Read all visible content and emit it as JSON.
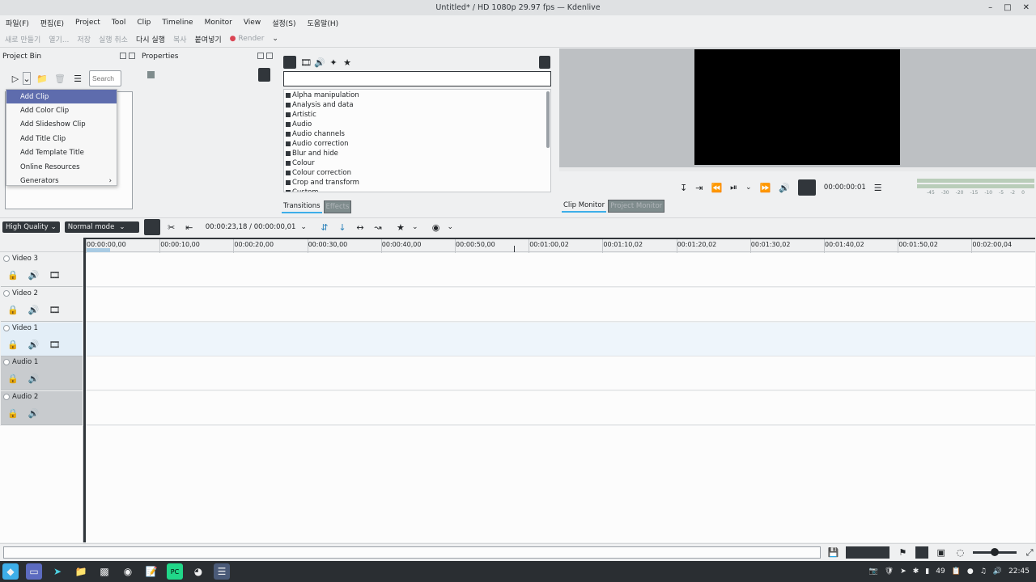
{
  "window": {
    "title": "Untitled* / HD 1080p 29.97 fps — Kdenlive"
  },
  "menubar": [
    "파일(F)",
    "편집(E)",
    "Project",
    "Tool",
    "Clip",
    "Timeline",
    "Monitor",
    "View",
    "설정(S)",
    "도움말(H)"
  ],
  "toolbar": {
    "new": "새로 만들기",
    "open": "열기...",
    "save": "저장",
    "undo": "실행 취소",
    "redo": "다시 실행",
    "copy": "복사",
    "paste": "붙여넣기",
    "render": "Render"
  },
  "project_bin": {
    "title": "Project Bin",
    "search_placeholder": "Search"
  },
  "add_menu": {
    "items": [
      "Add Clip",
      "Add Color Clip",
      "Add Slideshow Clip",
      "Add Title Clip",
      "Add Template Title",
      "Online Resources",
      "Generators"
    ],
    "selected": "Add Clip"
  },
  "properties": {
    "title": "Properties"
  },
  "effects": {
    "categories": [
      "Alpha manipulation",
      "Analysis and data",
      "Artistic",
      "Audio",
      "Audio channels",
      "Audio correction",
      "Blur and hide",
      "Colour",
      "Colour correction",
      "Crop and transform",
      "Custom"
    ],
    "tabs": [
      "Transitions",
      "Effects"
    ]
  },
  "monitor": {
    "timecode": "00:00:00:01",
    "tabs": [
      "Clip Monitor",
      "Project Monitor"
    ],
    "meter_labels": [
      "-45",
      "-30",
      "-20",
      "-15",
      "-10",
      "-5",
      "-2",
      "0"
    ]
  },
  "timeline_toolbar": {
    "quality": "High Quality",
    "mode": "Normal mode",
    "timecode": "00:00:23,18 / 00:00:00,01"
  },
  "ruler": [
    "00:00:00,00",
    "00:00:10,00",
    "00:00:20,00",
    "00:00:30,00",
    "00:00:40,00",
    "00:00:50,00",
    "00:01:00,02",
    "00:01:10,02",
    "00:01:20,02",
    "00:01:30,02",
    "00:01:40,02",
    "00:01:50,02",
    "00:02:00,04"
  ],
  "tracks": [
    {
      "name": "Video 3",
      "type": "video"
    },
    {
      "name": "Video 2",
      "type": "video"
    },
    {
      "name": "Video 1",
      "type": "video"
    },
    {
      "name": "Audio 1",
      "type": "audio"
    },
    {
      "name": "Audio 2",
      "type": "audio"
    }
  ],
  "taskbar": {
    "clock": "22:45",
    "battery": "49"
  }
}
